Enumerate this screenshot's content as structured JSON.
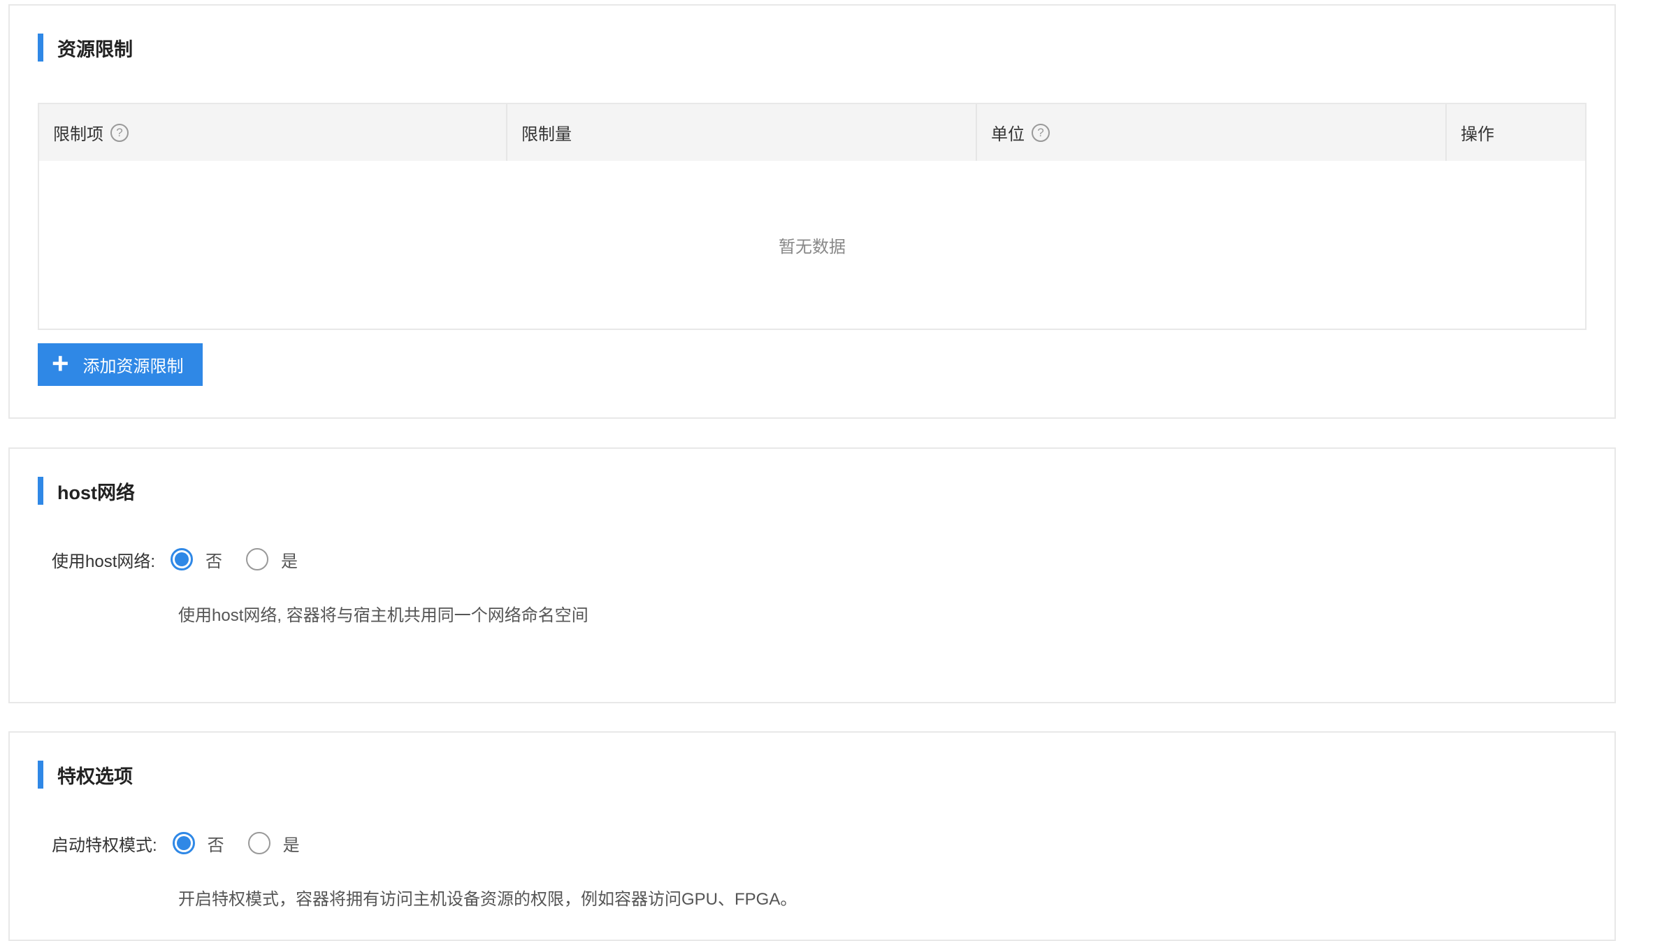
{
  "resource_limit": {
    "title": "资源限制",
    "columns": [
      "限制项",
      "限制量",
      "单位",
      "操作"
    ],
    "empty_text": "暂无数据",
    "add_button_label": "添加资源限制"
  },
  "host_network": {
    "title": "host网络",
    "field_label": "使用host网络:",
    "options": [
      "否",
      "是"
    ],
    "selected": "否",
    "help": "使用host网络, 容器将与宿主机共用同一个网络命名空间"
  },
  "privilege": {
    "title": "特权选项",
    "field_label": "启动特权模式:",
    "options": [
      "否",
      "是"
    ],
    "selected": "否",
    "help": "开启特权模式，容器将拥有访问主机设备资源的权限，例如容器访问GPU、FPGA。"
  },
  "colors": {
    "accent": "#2f88e6",
    "border": "#e8e8e8",
    "header_bg": "#f4f4f4"
  }
}
